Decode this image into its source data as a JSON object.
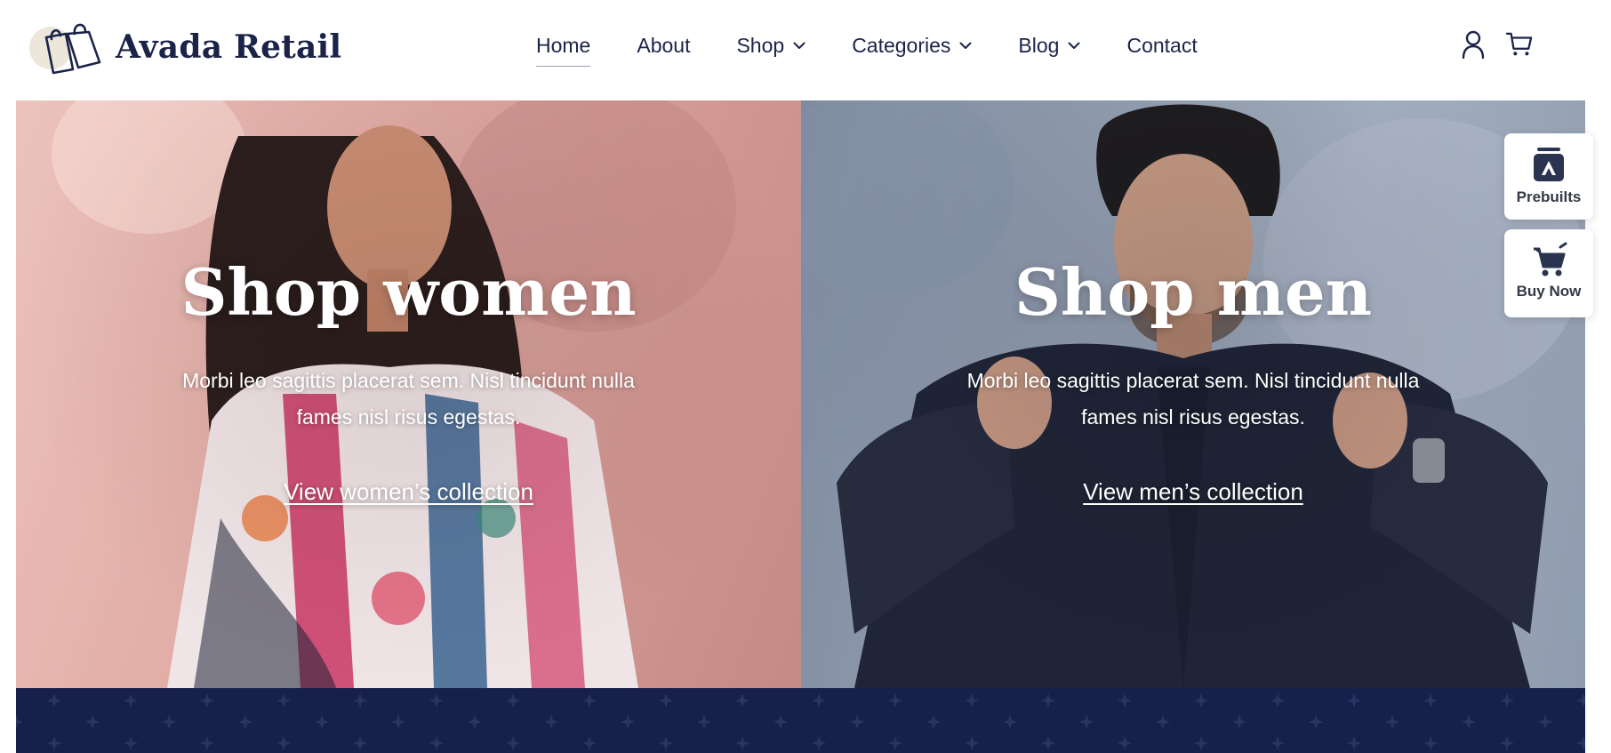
{
  "brand": {
    "name": "Avada Retail",
    "accent": "#1b2349"
  },
  "nav": {
    "items": [
      {
        "label": "Home",
        "active": true,
        "dropdown": false
      },
      {
        "label": "About",
        "active": false,
        "dropdown": false
      },
      {
        "label": "Shop",
        "active": false,
        "dropdown": true
      },
      {
        "label": "Categories",
        "active": false,
        "dropdown": true
      },
      {
        "label": "Blog",
        "active": false,
        "dropdown": true
      },
      {
        "label": "Contact",
        "active": false,
        "dropdown": false
      }
    ]
  },
  "header_icons": [
    "user-icon",
    "cart-icon"
  ],
  "hero": {
    "women": {
      "title": "Shop women",
      "description": "Morbi leo sagittis placerat sem. Nisl tincidunt nulla fames nisl risus egestas.",
      "link": "View women’s collection"
    },
    "men": {
      "title": "Shop men",
      "description": "Morbi leo sagittis placerat sem. Nisl tincidunt nulla fames nisl risus egestas.",
      "link": "View men’s collection"
    }
  },
  "band_color": "#17204a",
  "side_buttons": {
    "prebuilts": {
      "label": "Prebuilts",
      "icon": "prebuilts-icon"
    },
    "buy_now": {
      "label": "Buy Now",
      "icon": "cart-icon"
    }
  }
}
